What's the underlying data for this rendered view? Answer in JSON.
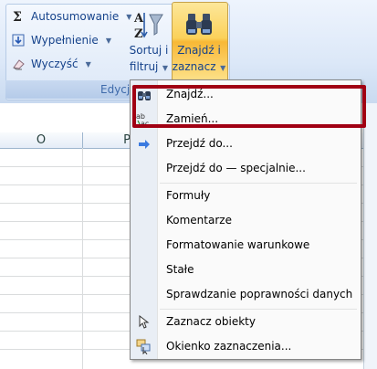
{
  "ribbon": {
    "edit_group": {
      "caption": "Edycja",
      "autosum_label": "Autosumowanie",
      "fill_label": "Wypełnienie",
      "clear_label": "Wyczyść",
      "sort_line1": "Sortuj i",
      "sort_line2": "filtruj",
      "find_line1": "Znajdź i",
      "find_line2": "zaznacz"
    }
  },
  "sheet": {
    "columns": [
      "O",
      "P"
    ]
  },
  "find_menu": {
    "items": [
      {
        "label": "Znajdź...",
        "icon": "binoculars-icon"
      },
      {
        "label": "Zamień...",
        "icon": "replace-icon"
      },
      {
        "label": "Przejdź do...",
        "icon": "arrow-right-icon"
      },
      {
        "label": "Przejdź do — specjalnie...",
        "icon": ""
      },
      {
        "label": "Formuły",
        "icon": ""
      },
      {
        "label": "Komentarze",
        "icon": ""
      },
      {
        "label": "Formatowanie warunkowe",
        "icon": ""
      },
      {
        "label": "Stałe",
        "icon": ""
      },
      {
        "label": "Sprawdzanie poprawności danych",
        "icon": ""
      },
      {
        "label": "Zaznacz obiekty",
        "icon": "cursor-arrow-icon"
      },
      {
        "label": "Okienko zaznaczenia...",
        "icon": "selection-pane-icon"
      }
    ]
  },
  "colors": {
    "highlight_border": "#a10013",
    "ribbon_text": "#15428b",
    "button_active": "#f8b836"
  }
}
